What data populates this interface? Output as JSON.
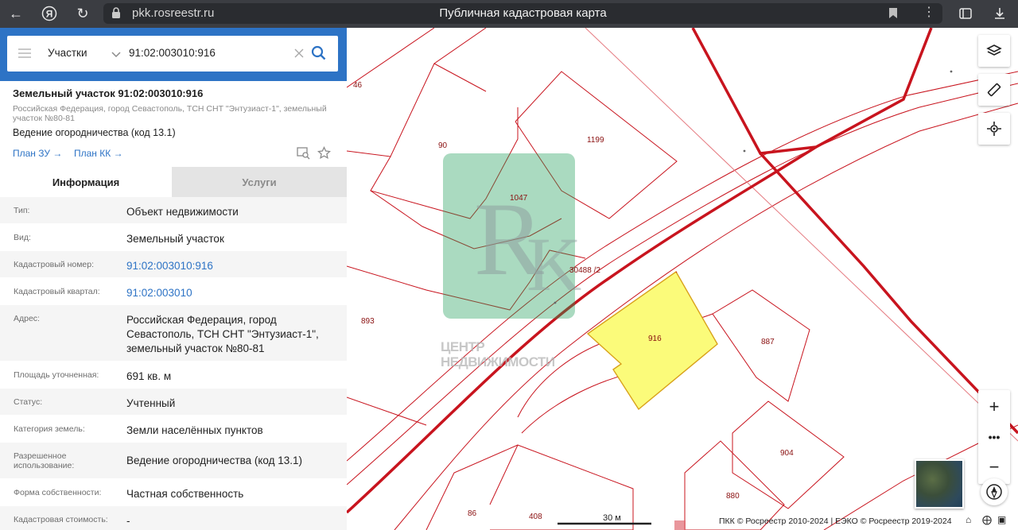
{
  "browser": {
    "url": "pkk.rosreestr.ru",
    "tab_title": "Публичная кадастровая карта"
  },
  "search": {
    "category": "Участки",
    "query": "91:02:003010:916"
  },
  "object": {
    "title": "Земельный участок 91:02:003010:916",
    "address_short": "Российская Федерация, город Севастополь, ТСН СНТ \"Энтузиаст-1\", земельный участок №80-81",
    "use": "Ведение огородничества (код 13.1)",
    "link_plan_zu": "План ЗУ →",
    "link_plan_kk": "План КК →"
  },
  "tabs": [
    "Информация",
    "Услуги"
  ],
  "rows": [
    {
      "label": "Тип:",
      "value": "Объект недвижимости"
    },
    {
      "label": "Вид:",
      "value": "Земельный участок"
    },
    {
      "label": "Кадастровый номер:",
      "value": "91:02:003010:916"
    },
    {
      "label": "Кадастровый квартал:",
      "value": "91:02:003010"
    },
    {
      "label": "Адрес:",
      "value": "Российская Федерация, город Севастополь, ТСН СНТ \"Энтузиаст-1\", земельный участок №80-81"
    },
    {
      "label": "Площадь уточненная:",
      "value": "691 кв. м"
    },
    {
      "label": "Статус:",
      "value": "Учтенный"
    },
    {
      "label": "Категория земель:",
      "value": "Земли населённых пунктов"
    },
    {
      "label": "Разрешенное использование:",
      "value": "Ведение огородничества (код 13.1)"
    },
    {
      "label": "Форма собственности:",
      "value": "Частная собственность"
    },
    {
      "label": "Кадастровая стоимость:",
      "value": "-"
    }
  ],
  "map": {
    "parcel_labels": [
      "46",
      "90",
      "1199",
      "1047",
      "30488 /2",
      "893",
      "916",
      "887",
      "904",
      "880",
      "86",
      "408"
    ],
    "watermark": "ЦЕНТР НЕДВИЖИМОСТИ",
    "scale": "30 м",
    "copyright": "ПКК © Росреестр 2010-2024 | ЕЭКО © Росреестр 2019-2024",
    "colors": {
      "parcel_line": "#c8141e",
      "selected_fill": "#fbfb7a",
      "watermark": "#1f9e5a"
    }
  }
}
